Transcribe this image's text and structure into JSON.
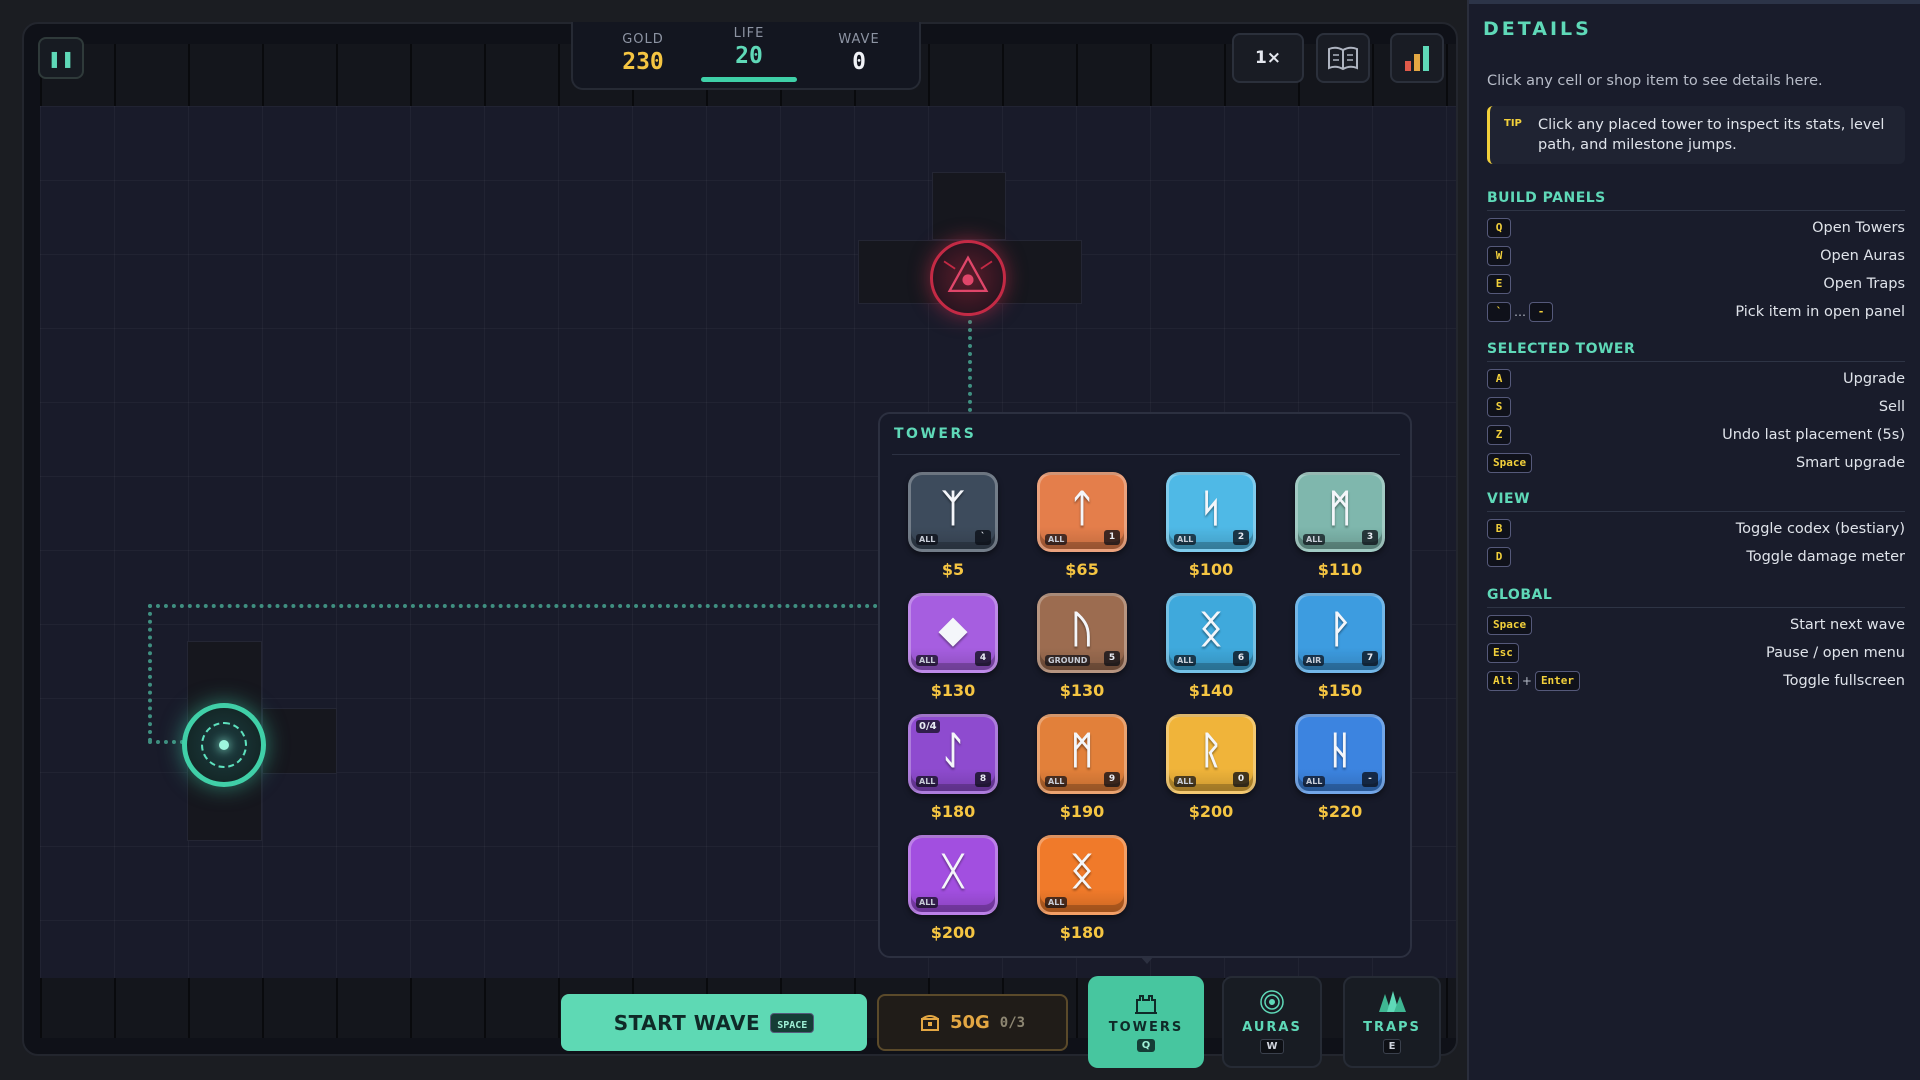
{
  "hud": {
    "pause_icon": "pause-icon",
    "gold_label": "GOLD",
    "gold": "230",
    "life_label": "LIFE",
    "life": "20",
    "life_fraction": 1.0,
    "wave_label": "WAVE",
    "wave": "0",
    "speed": "1×",
    "codex_icon": "book-icon",
    "meter_icon": "bar-chart-icon"
  },
  "colors": {
    "accent": "#5fd9b8",
    "gold": "#f5c542",
    "enemy_portal": "#c42a45",
    "tip": "#f2d03b"
  },
  "shop": {
    "title": "TOWERS",
    "towers": [
      {
        "glyph": "ᛉ",
        "target": "ALL",
        "hotkey": "`",
        "price": "$5",
        "color": "#3d4b5c"
      },
      {
        "glyph": "ᛏ",
        "target": "ALL",
        "hotkey": "1",
        "price": "$65",
        "color": "#e47e4b"
      },
      {
        "glyph": "ᛋ",
        "target": "ALL",
        "hotkey": "2",
        "price": "$100",
        "color": "#4fb9e6"
      },
      {
        "glyph": "ᛗ",
        "target": "ALL",
        "hotkey": "3",
        "price": "$110",
        "color": "#7fb7ad"
      },
      {
        "glyph": "◆",
        "target": "ALL",
        "hotkey": "4",
        "price": "$130",
        "color": "#a65ee0"
      },
      {
        "glyph": "ᚢ",
        "target": "GROUND",
        "hotkey": "5",
        "price": "$130",
        "color": "#9c6c50"
      },
      {
        "glyph": "ᛝ",
        "target": "ALL",
        "hotkey": "6",
        "price": "$140",
        "color": "#3fa9dc"
      },
      {
        "glyph": "ᚹ",
        "target": "AIR",
        "hotkey": "7",
        "price": "$150",
        "color": "#3d9ce0"
      },
      {
        "glyph": "ᛇ",
        "target": "ALL",
        "hotkey": "8",
        "price": "$180",
        "color": "#8e4bcf",
        "count": "0/4"
      },
      {
        "glyph": "ᛗ",
        "target": "ALL",
        "hotkey": "9",
        "price": "$190",
        "color": "#e2803a"
      },
      {
        "glyph": "ᚱ",
        "target": "ALL",
        "hotkey": "0",
        "price": "$200",
        "color": "#f0b43a"
      },
      {
        "glyph": "ᚺ",
        "target": "ALL",
        "hotkey": "-",
        "price": "$220",
        "color": "#3c84e0"
      },
      {
        "glyph": "ᚷ",
        "target": "ALL",
        "hotkey": "",
        "price": "$200",
        "color": "#a24fe0"
      },
      {
        "glyph": "ᛝ",
        "target": "ALL",
        "hotkey": "",
        "price": "$180",
        "color": "#f07a2a"
      }
    ]
  },
  "bottom": {
    "start_wave": "START WAVE",
    "start_key": "SPACE",
    "cost_icon": "treasure-chest-icon",
    "cost": "50G",
    "cost_count": "0/3",
    "tabs": {
      "towers": {
        "label": "TOWERS",
        "key": "Q",
        "icon": "castle-icon"
      },
      "auras": {
        "label": "AURAS",
        "key": "W",
        "icon": "radar-icon"
      },
      "traps": {
        "label": "TRAPS",
        "key": "E",
        "icon": "spikes-icon"
      }
    }
  },
  "details": {
    "title": "DETAILS",
    "hint": "Click any cell or shop item to see details here.",
    "tip_label": "TIP",
    "tip": "Click any placed tower to inspect its stats, level path, and milestone jumps.",
    "sections": {
      "build": {
        "title": "BUILD PANELS",
        "rows": [
          {
            "keys": [
              "Q"
            ],
            "action": "Open Towers"
          },
          {
            "keys": [
              "W"
            ],
            "action": "Open Auras"
          },
          {
            "keys": [
              "E"
            ],
            "action": "Open Traps"
          },
          {
            "keys": [
              "`",
              "…",
              "-"
            ],
            "action": "Pick item in open panel"
          }
        ]
      },
      "selected": {
        "title": "SELECTED TOWER",
        "rows": [
          {
            "keys": [
              "A"
            ],
            "action": "Upgrade"
          },
          {
            "keys": [
              "S"
            ],
            "action": "Sell"
          },
          {
            "keys": [
              "Z"
            ],
            "action": "Undo last placement (5s)"
          },
          {
            "keys": [
              "Space"
            ],
            "action": "Smart upgrade"
          }
        ]
      },
      "view": {
        "title": "VIEW",
        "rows": [
          {
            "keys": [
              "B"
            ],
            "action": "Toggle codex (bestiary)"
          },
          {
            "keys": [
              "D"
            ],
            "action": "Toggle damage meter"
          }
        ]
      },
      "global": {
        "title": "GLOBAL",
        "rows": [
          {
            "keys": [
              "Space"
            ],
            "action": "Start next wave"
          },
          {
            "keys": [
              "Esc"
            ],
            "action": "Pause / open menu"
          },
          {
            "keys": [
              "Alt",
              "+",
              "Enter"
            ],
            "action": "Toggle fullscreen"
          }
        ]
      }
    }
  }
}
